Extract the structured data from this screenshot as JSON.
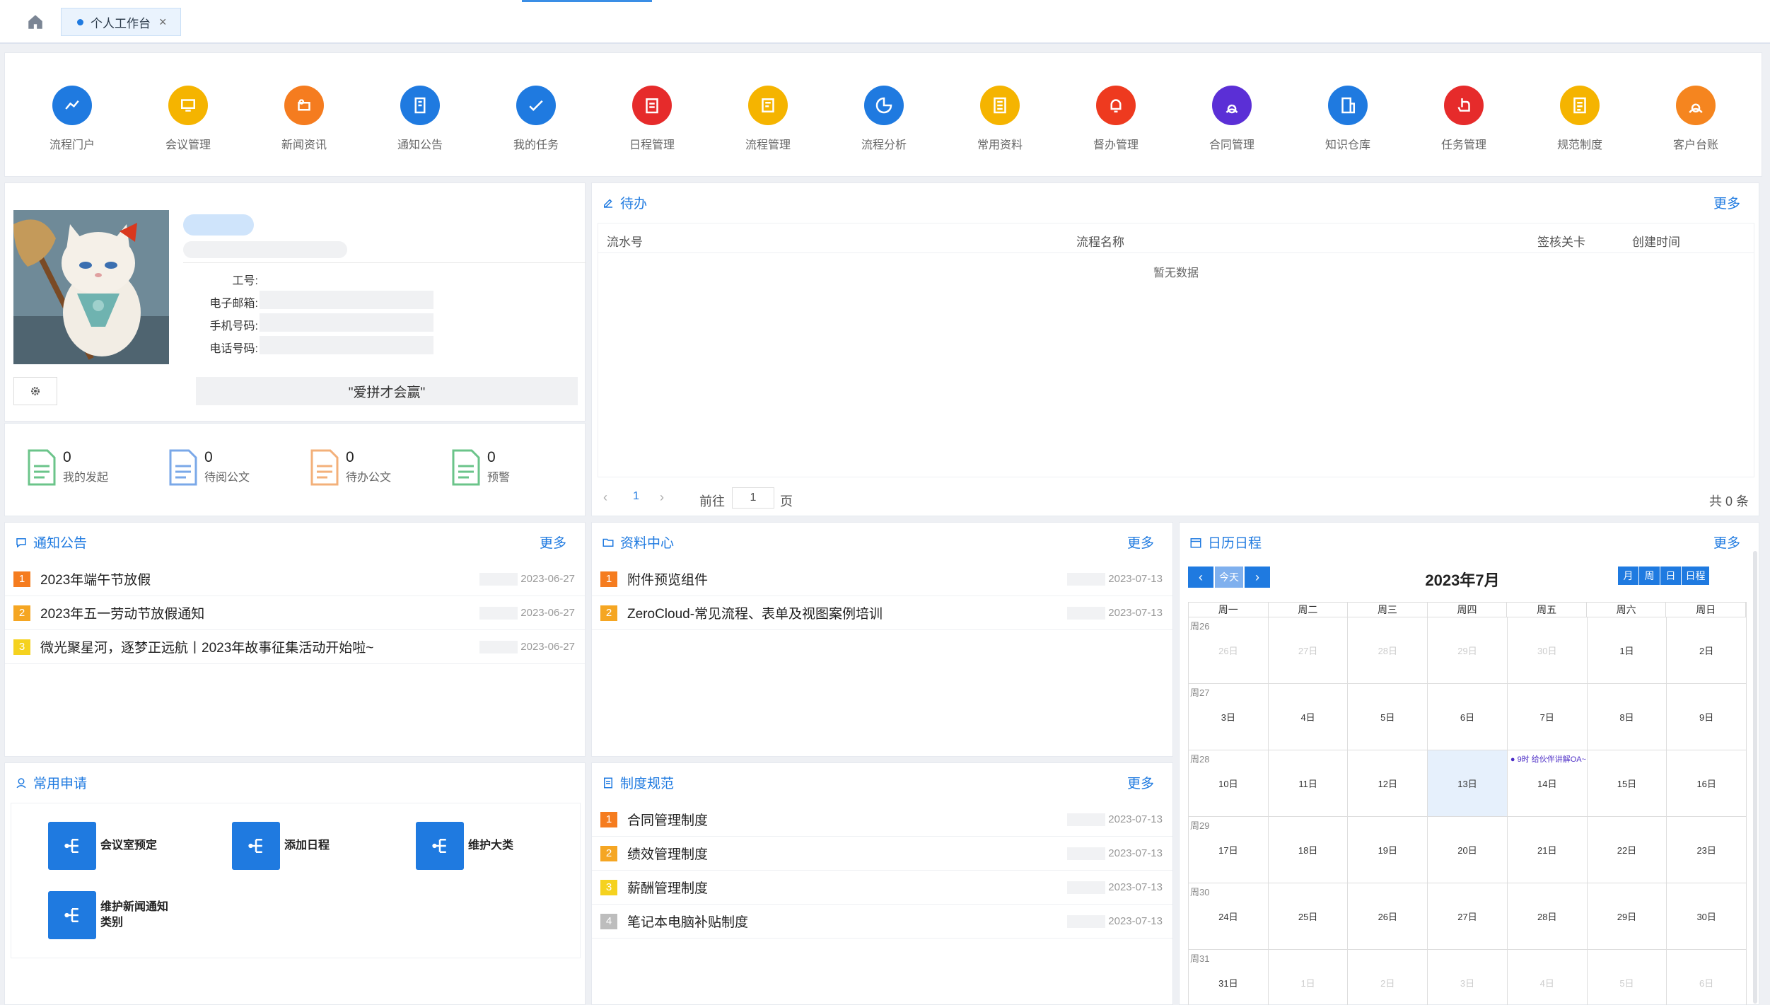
{
  "topbar": {
    "tab_label": "个人工作台"
  },
  "quick_links": [
    {
      "label": "流程门户",
      "color": "#1f7ae0"
    },
    {
      "label": "会议管理",
      "color": "#f5b400"
    },
    {
      "label": "新闻资讯",
      "color": "#f57c1f"
    },
    {
      "label": "通知公告",
      "color": "#1f7ae0"
    },
    {
      "label": "我的任务",
      "color": "#1f7ae0"
    },
    {
      "label": "日程管理",
      "color": "#e62b2b"
    },
    {
      "label": "流程管理",
      "color": "#f5b400"
    },
    {
      "label": "流程分析",
      "color": "#1f7ae0"
    },
    {
      "label": "常用资料",
      "color": "#f5b400"
    },
    {
      "label": "督办管理",
      "color": "#ee3a1f"
    },
    {
      "label": "合同管理",
      "color": "#5b2fd6"
    },
    {
      "label": "知识仓库",
      "color": "#1f7ae0"
    },
    {
      "label": "任务管理",
      "color": "#e62b2b"
    },
    {
      "label": "规范制度",
      "color": "#f5b400"
    },
    {
      "label": "客户台账",
      "color": "#f5851f"
    }
  ],
  "profile": {
    "fields": [
      "工号:",
      "电子邮箱:",
      "手机号码:",
      "电话号码:"
    ],
    "motto": "\"爱拼才会赢\""
  },
  "stats": [
    {
      "value": "0",
      "label": "我的发起",
      "color": "#6bc48a"
    },
    {
      "value": "0",
      "label": "待阅公文",
      "color": "#7aa8e8"
    },
    {
      "value": "0",
      "label": "待办公文",
      "color": "#f3b07a"
    },
    {
      "value": "0",
      "label": "预警",
      "color": "#6bc48a"
    }
  ],
  "todo": {
    "title": "待办",
    "more": "更多",
    "columns": [
      "流水号",
      "流程名称",
      "签核关卡",
      "创建时间"
    ],
    "empty": "暂无数据",
    "pager": {
      "page": "1",
      "goto_prefix": "前往",
      "goto_value": "1",
      "goto_suffix": "页",
      "total": "共 0 条"
    }
  },
  "notice": {
    "title": "通知公告",
    "more": "更多",
    "items": [
      {
        "num": "1",
        "title": "2023年端午节放假",
        "date": "2023-06-27"
      },
      {
        "num": "2",
        "title": "2023年五一劳动节放假通知",
        "date": "2023-06-27"
      },
      {
        "num": "3",
        "title": "微光聚星河，逐梦正远航丨2023年故事征集活动开始啦~",
        "date": "2023-06-27"
      }
    ]
  },
  "files": {
    "title": "资料中心",
    "more": "更多",
    "items": [
      {
        "num": "1",
        "title": "附件预览组件",
        "date": "2023-07-13"
      },
      {
        "num": "2",
        "title": "ZeroCloud-常见流程、表单及视图案例培训",
        "date": "2023-07-13"
      }
    ]
  },
  "calendar": {
    "title": "日历日程",
    "more": "更多",
    "month_title": "2023年7月",
    "today_label": "今天",
    "views": [
      "月",
      "周",
      "日",
      "日程"
    ],
    "weekdays": [
      "周一",
      "周二",
      "周三",
      "周四",
      "周五",
      "周六",
      "周日"
    ],
    "weeks": [
      {
        "wk": "周26",
        "days": [
          "26日",
          "27日",
          "28日",
          "29日",
          "30日",
          "1日",
          "2日"
        ]
      },
      {
        "wk": "周27",
        "days": [
          "3日",
          "4日",
          "5日",
          "6日",
          "7日",
          "8日",
          "9日"
        ]
      },
      {
        "wk": "周28",
        "days": [
          "10日",
          "11日",
          "12日",
          "13日",
          "14日",
          "15日",
          "16日"
        ]
      },
      {
        "wk": "周29",
        "days": [
          "17日",
          "18日",
          "19日",
          "20日",
          "21日",
          "22日",
          "23日"
        ]
      },
      {
        "wk": "周30",
        "days": [
          "24日",
          "25日",
          "26日",
          "27日",
          "28日",
          "29日",
          "30日"
        ]
      },
      {
        "wk": "周31",
        "days": [
          "31日",
          "1日",
          "2日",
          "3日",
          "4日",
          "5日",
          "6日"
        ]
      }
    ],
    "event": "9时 给伙伴讲解OA~"
  },
  "common": {
    "title": "常用申请",
    "items": [
      "会议室预定",
      "添加日程",
      "维护大类",
      "维护新闻通知类别"
    ]
  },
  "rules": {
    "title": "制度规范",
    "more": "更多",
    "items": [
      {
        "num": "1",
        "title": "合同管理制度",
        "date": "2023-07-13"
      },
      {
        "num": "2",
        "title": "绩效管理制度",
        "date": "2023-07-13"
      },
      {
        "num": "3",
        "title": "薪酬管理制度",
        "date": "2023-07-13"
      },
      {
        "num": "4",
        "title": "笔记本电脑补贴制度",
        "date": "2023-07-13"
      }
    ]
  }
}
